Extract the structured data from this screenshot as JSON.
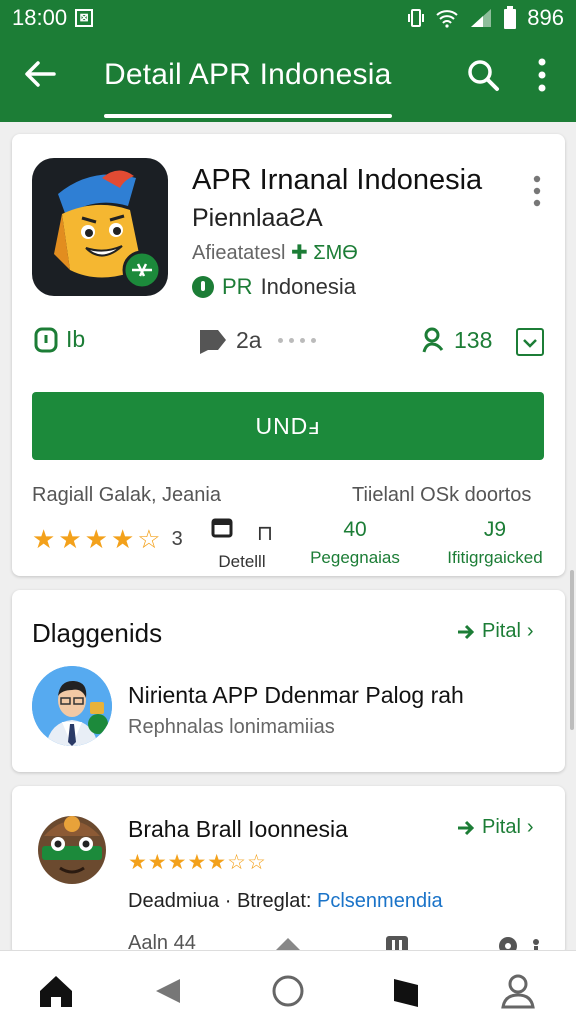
{
  "status": {
    "time": "18:00",
    "battery": "896"
  },
  "appbar": {
    "title": "Detail APR Indonesia"
  },
  "app": {
    "title": "APR Irnanal Indonesia",
    "subtitle": "PiennlaaƧA",
    "meta_prefix": "Aﬁeatatesl",
    "meta_suffix": "✚ ΣMӨ",
    "developer_prefix": "PR",
    "developer": "Indonesia",
    "stat1": "Ib",
    "stat2": "2a",
    "stat3": "138",
    "install_label": "UNDⅎ",
    "meta_left": "Ragiall Galak, Jeania",
    "meta_right": "Tiielanl OSk doortos",
    "rating_count": "3",
    "col_a_top": "⊓",
    "col_a_label": "Detelll",
    "col_b_top": "40",
    "col_b_label": "Pegegnaias",
    "col_c_top": "J9",
    "col_c_label": "Ifitigrgaicked",
    "star_color": "#f3a11b",
    "accent_color": "#1c7d36"
  },
  "section": {
    "title": "Dlaggenids",
    "link": "Pital",
    "item_title": "Nirienta APP Ddenmar Palog rah",
    "item_sub": "Rephnalas lonimamiias"
  },
  "card3": {
    "title": "Braha Brall Ioonnesia",
    "link": "Pital",
    "meta_left": "Deadmiua",
    "meta_mid": "Btreglat:",
    "meta_link": "Pclsenmendia",
    "cutoff": "Aaln 44"
  }
}
